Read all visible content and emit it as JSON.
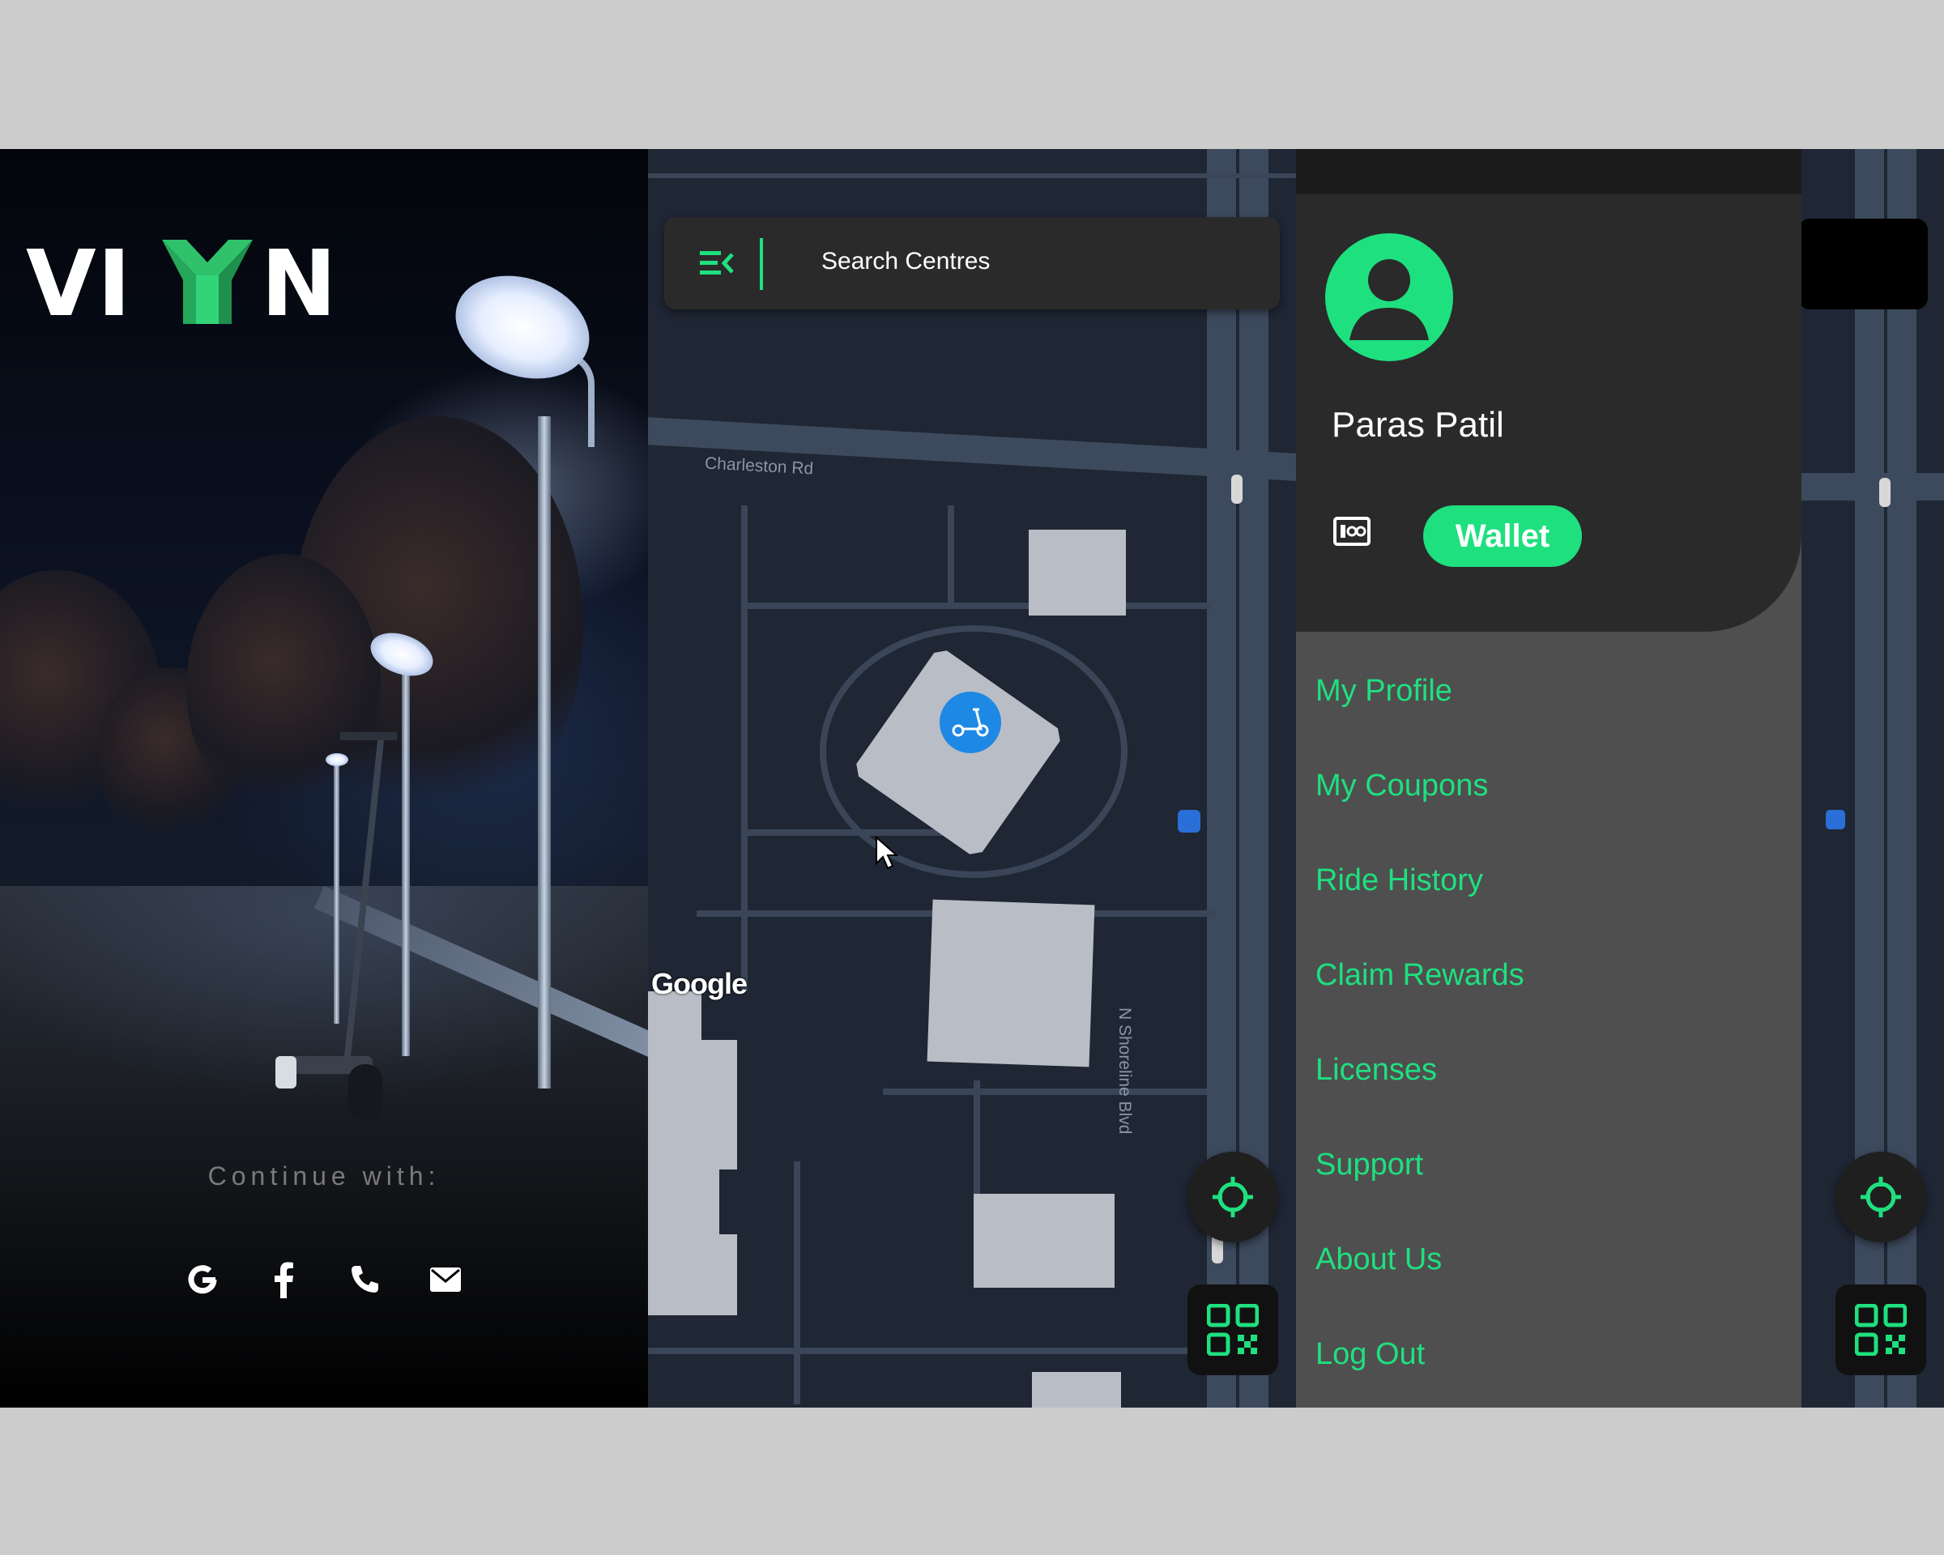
{
  "login": {
    "brand": "VIYN",
    "continue_label": "Continue with:",
    "social_icons": [
      "google-icon",
      "facebook-icon",
      "phone-icon",
      "email-icon"
    ]
  },
  "map": {
    "search_placeholder": "Search Centres",
    "road_label_1": "Charleston Rd",
    "road_label_2": "N Shoreline Blvd",
    "attribution": "Google",
    "icons": [
      "menu-icon",
      "scooter-marker-icon",
      "bus-stop-icon",
      "traffic-light-icon",
      "locate-icon",
      "qr-code-icon"
    ]
  },
  "drawer": {
    "user_name": "Paras Patil",
    "wallet_label": "Wallet",
    "menu": [
      {
        "label": "My Profile"
      },
      {
        "label": "My Coupons"
      },
      {
        "label": "Ride History"
      },
      {
        "label": "Claim Rewards"
      },
      {
        "label": "Licenses"
      },
      {
        "label": "Support"
      },
      {
        "label": "About Us"
      },
      {
        "label": "Log Out"
      }
    ]
  },
  "colors": {
    "accent": "#1EE07F",
    "background": "#CCCCCC",
    "drawer_bg": "#4F4F4F",
    "drawer_header": "#2A2A2A",
    "map_bg": "#1F2634",
    "marker_blue": "#1E88E5"
  }
}
